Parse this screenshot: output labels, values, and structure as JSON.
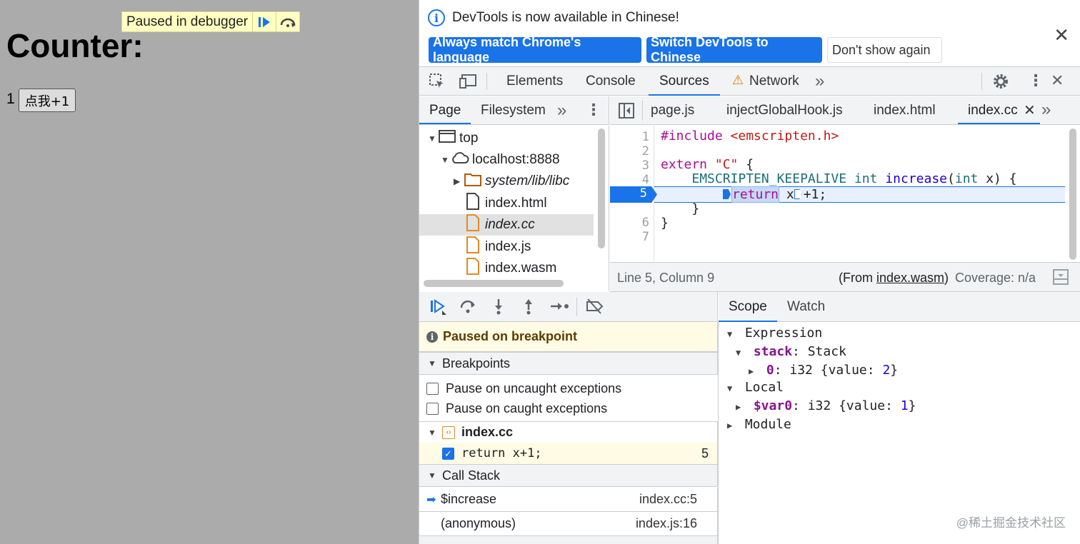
{
  "page": {
    "overlay_text": "Paused in debugger",
    "title": "Counter:",
    "count": "1",
    "button_label": "点我+1"
  },
  "infobar": {
    "message": "DevTools is now available in Chinese!",
    "btn_match": "Always match Chrome's language",
    "btn_switch": "Switch DevTools to Chinese",
    "btn_dismiss": "Don't show again",
    "close": "✕"
  },
  "main_tabs": {
    "elements": "Elements",
    "console": "Console",
    "sources": "Sources",
    "network": "Network",
    "warning": "⚠",
    "more": "»"
  },
  "navigator": {
    "tab_page": "Page",
    "tab_filesystem": "Filesystem",
    "more": "»",
    "tree": [
      {
        "label": "top",
        "arrow": "▼",
        "icon": "▭"
      },
      {
        "label": "localhost:8888",
        "arrow": "▼",
        "icon": "☁"
      },
      {
        "label": "system/lib/libc",
        "arrow": "▶",
        "icon": "folder"
      },
      {
        "label": "index.html",
        "arrow": "",
        "icon": "file"
      },
      {
        "label": "index.cc",
        "arrow": "",
        "icon": "file"
      },
      {
        "label": "index.js",
        "arrow": "",
        "icon": "file"
      },
      {
        "label": "index.wasm",
        "arrow": "",
        "icon": "file"
      }
    ]
  },
  "editor": {
    "tabs": [
      "page.js",
      "injectGlobalHook.js",
      "index.html",
      "index.cc"
    ],
    "tab_close": "✕",
    "tab_more": "»",
    "line_numbers": [
      "1",
      "2",
      "3",
      "4",
      "5",
      "6",
      "7"
    ],
    "active_line": "5",
    "code": {
      "l1_kw": "#include",
      "l1_str": "<emscripten.h>",
      "l3_kw": "extern",
      "l3_str": "\"C\"",
      "l3_rest": " {",
      "l4_indent": "    ",
      "l4_macro": "EMSCRIPTEN_KEEPALIVE",
      "l4_type": "int",
      "l4_fn": "increase",
      "l4_paren": "(",
      "l4_argtype": "int",
      "l4_rest": " x) {",
      "l5_kw": "return",
      "l5_a": " x",
      "l5_b": "+1;",
      "l6": "    }",
      "l7": "}"
    },
    "status": {
      "position": "Line 5, Column 9",
      "from_prefix": "(From ",
      "from_file": "index.wasm",
      "from_suffix": ")",
      "coverage": "Coverage: n/a"
    }
  },
  "debugger": {
    "paused_message": "Paused on breakpoint",
    "breakpoints_header": "Breakpoints",
    "pause_uncaught": "Pause on uncaught exceptions",
    "pause_caught": "Pause on caught exceptions",
    "bp_file": "index.cc",
    "bp_code": "return x+1;",
    "bp_line": "5",
    "callstack_header": "Call Stack",
    "frames": [
      {
        "name": "$increase",
        "location": "index.cc:5"
      },
      {
        "name": "(anonymous)",
        "location": "index.js:16"
      }
    ]
  },
  "scope": {
    "tab_scope": "Scope",
    "tab_watch": "Watch",
    "expression": "Expression",
    "stack_key": "stack",
    "stack_val": "Stack",
    "item0_key": "0",
    "item0_type": "i32",
    "item0_value": "2",
    "local": "Local",
    "var0_key": "$var0",
    "var0_type": "i32",
    "var0_value": "1",
    "module": "Module"
  },
  "watermark": "@稀土掘金技术社区"
}
